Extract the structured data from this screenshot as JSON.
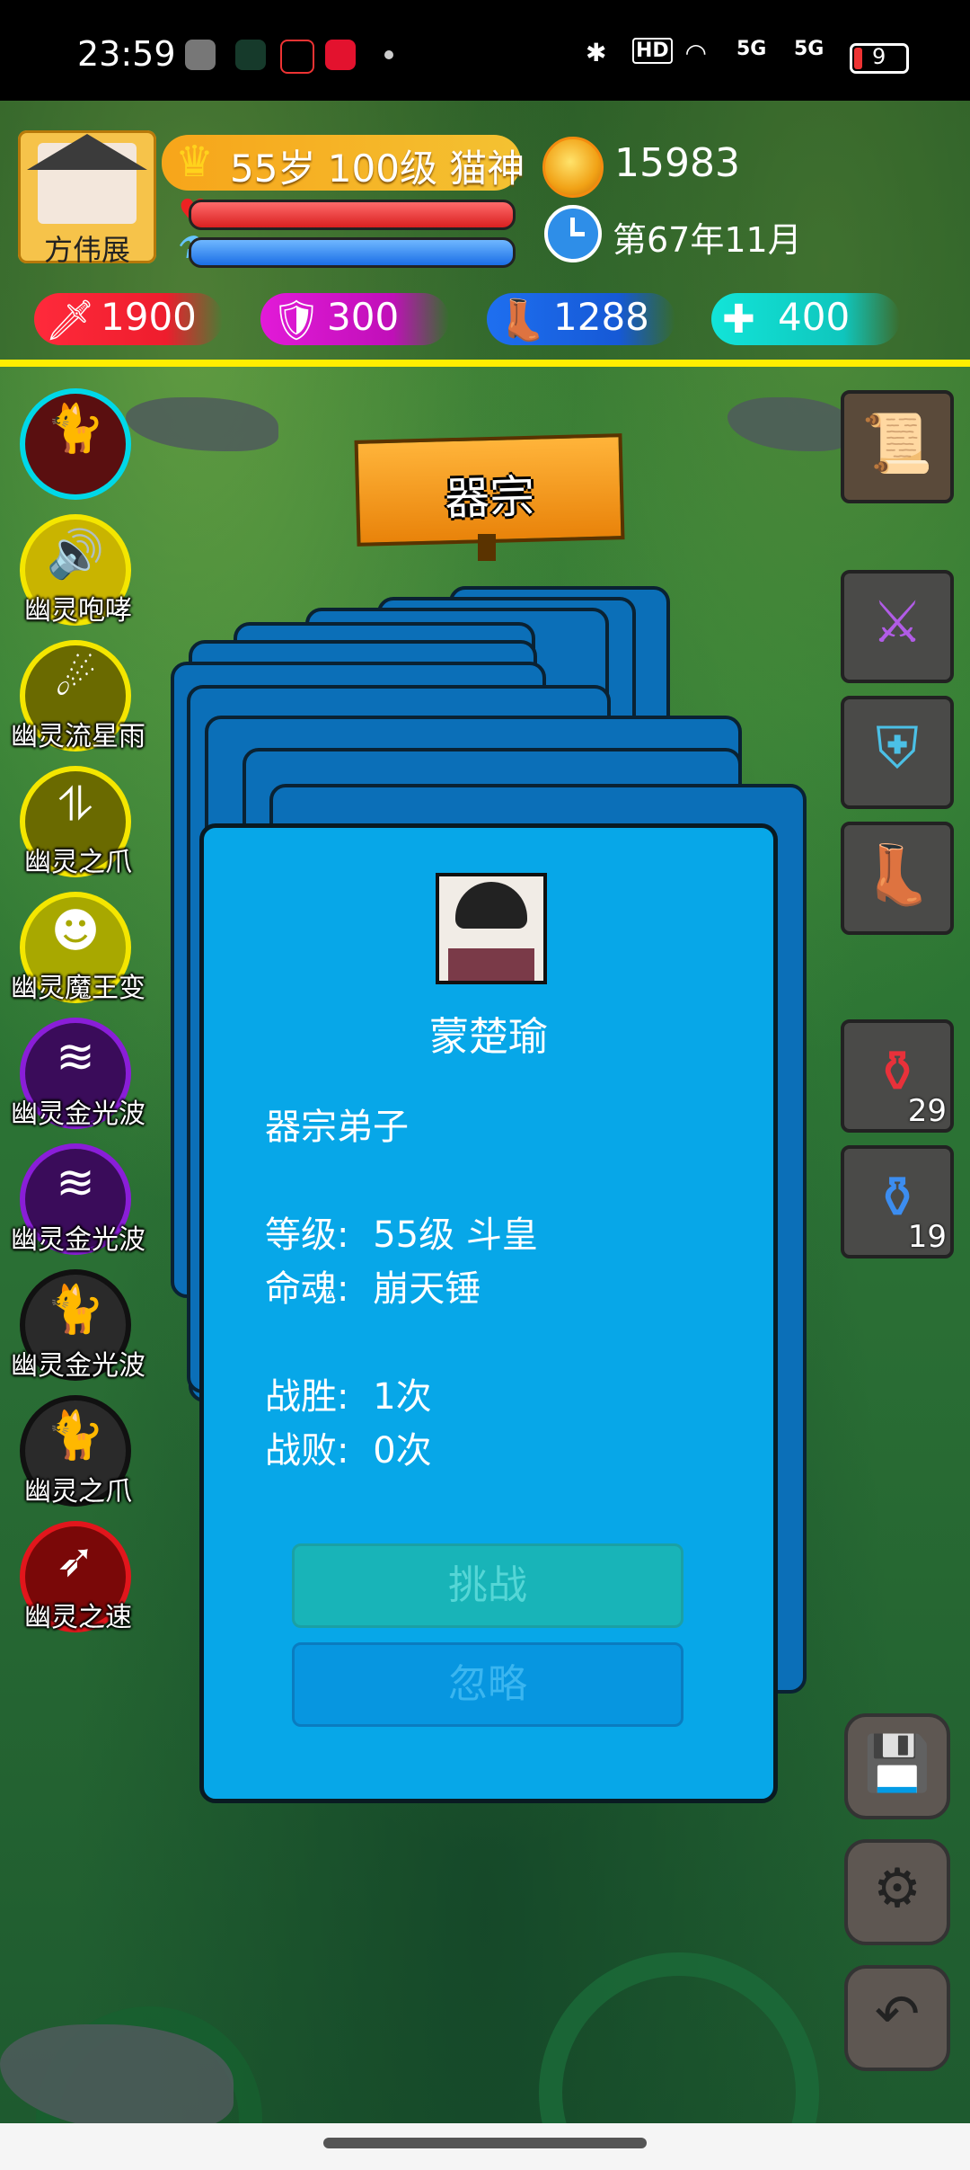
{
  "status_bar": {
    "time": "23:59",
    "hd": "HD",
    "net1": "5G",
    "net2": "5G",
    "battery": "9"
  },
  "player": {
    "name": "方伟展",
    "level_text": "55岁 100级 猫神",
    "gold": "15983",
    "date": "第67年11月"
  },
  "stats": {
    "attack": "1900",
    "defense": "300",
    "speed": "1288",
    "hp": "400"
  },
  "skills": [
    {
      "label": "",
      "icon": "cat-icon",
      "ring": "#00d8e8",
      "fill": "#5a0f10"
    },
    {
      "label": "幽灵咆哮",
      "icon": "roar-icon",
      "ring": "#f4e600",
      "fill": "#c9b400"
    },
    {
      "label": "幽灵流星雨",
      "icon": "meteor-icon",
      "ring": "#f4e600",
      "fill": "#6a6a00"
    },
    {
      "label": "幽灵之爪",
      "icon": "claw-icon",
      "ring": "#f4e600",
      "fill": "#6a6a00"
    },
    {
      "label": "幽灵魔王变",
      "icon": "demon-mask-icon",
      "ring": "#f4e600",
      "fill": "#a8a800"
    },
    {
      "label": "幽灵金光波",
      "icon": "wave-icon",
      "ring": "#8a1ed8",
      "fill": "#3a0c5a"
    },
    {
      "label": "幽灵金光波",
      "icon": "wave-icon",
      "ring": "#8a1ed8",
      "fill": "#3a0c5a"
    },
    {
      "label": "幽灵金光波",
      "icon": "cat-icon",
      "ring": "#111111",
      "fill": "#2a2a2a"
    },
    {
      "label": "幽灵之爪",
      "icon": "cat-icon",
      "ring": "#111111",
      "fill": "#2a2a2a"
    },
    {
      "label": "幽灵之速",
      "icon": "speed-icon",
      "ring": "#e2161c",
      "fill": "#7a0808"
    }
  ],
  "sign": {
    "title": "器宗"
  },
  "card": {
    "name": "蒙楚瑜",
    "title": "器宗弟子",
    "level_label": "等级:",
    "level_value": "55级 斗皇",
    "soul_label": "命魂:",
    "soul_value": "崩天锤",
    "wins_label": "战胜:",
    "wins_value": "1次",
    "losses_label": "战败:",
    "losses_value": "0次",
    "challenge_button": "挑战",
    "ignore_button": "忽略"
  },
  "inventory": {
    "map": "map-scroll-icon",
    "weapon": "sword-icon",
    "armor": "armor-icon",
    "boots": "boots-icon",
    "red_potion_count": "29",
    "blue_potion_count": "19"
  },
  "colors": {
    "card": "#07a7e8",
    "yellow_divider": "#ffee00"
  }
}
